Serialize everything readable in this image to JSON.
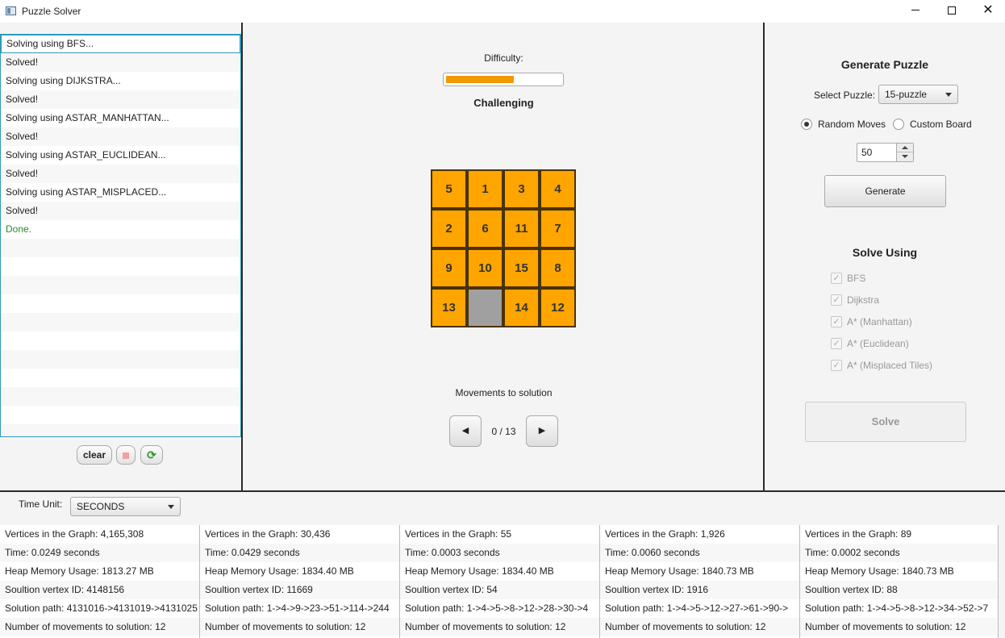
{
  "window": {
    "title": "Puzzle Solver",
    "minimize": "",
    "maximize": "",
    "close": "✕"
  },
  "log": {
    "entries": [
      "Solving using BFS...",
      "Solved!",
      "Solving using DIJKSTRA...",
      "Solved!",
      "Solving using ASTAR_MANHATTAN...",
      "Solved!",
      "Solving using ASTAR_EUCLIDEAN...",
      "Solved!",
      "Solving using ASTAR_MISPLACED...",
      "Solved!",
      "Done."
    ],
    "clear_label": "clear",
    "refresh_glyph": "⟳"
  },
  "center": {
    "difficulty_label": "Difficulty:",
    "difficulty_value": 0.59,
    "difficulty_level": "Challenging",
    "board": {
      "size": 4,
      "tiles": [
        "5",
        "1",
        "3",
        "4",
        "2",
        "6",
        "11",
        "7",
        "9",
        "10",
        "15",
        "8",
        "13",
        "",
        "14",
        "12"
      ]
    },
    "movements_label": "Movements to solution",
    "move_current": "0",
    "move_total": "13",
    "move_counter": "0 / 13",
    "prev_glyph": "◀",
    "next_glyph": "▶"
  },
  "generate": {
    "title": "Generate Puzzle",
    "select_label": "Select Puzzle:",
    "selected_puzzle": "15-puzzle",
    "random_moves_label": "Random Moves",
    "custom_board_label": "Custom Board",
    "selected_mode": "Random Moves",
    "moves_value": "50",
    "generate_label": "Generate"
  },
  "solve": {
    "title": "Solve Using",
    "algorithms": [
      "BFS",
      "Dijkstra",
      "A* (Manhattan)",
      "A* (Euclidean)",
      "A* (Misplaced Tiles)"
    ],
    "check_glyph": "✓",
    "solve_label": "Solve"
  },
  "bottom": {
    "time_unit_label": "Time Unit:",
    "time_unit_value": "SECONDS",
    "stats": [
      [
        "Vertices in the Graph: 4,165,308",
        "Time: 0.0249 seconds",
        "Heap Memory Usage: 1813.27 MB",
        "Soultion vertex ID: 4148156",
        "Solution path: 4131016->4131019->4131025",
        "Number of movements to solution: 12"
      ],
      [
        "Vertices in the Graph: 30,436",
        "Time: 0.0429 seconds",
        "Heap Memory Usage: 1834.40 MB",
        "Soultion vertex ID: 11669",
        "Solution path: 1->4->9->23->51->114->244",
        "Number of movements to solution: 12"
      ],
      [
        "Vertices in the Graph: 55",
        "Time: 0.0003 seconds",
        "Heap Memory Usage: 1834.40 MB",
        "Soultion vertex ID: 54",
        "Solution path: 1->4->5->8->12->28->30->4",
        "Number of movements to solution: 12"
      ],
      [
        "Vertices in the Graph: 1,926",
        "Time: 0.0060 seconds",
        "Heap Memory Usage: 1840.73 MB",
        "Soultion vertex ID: 1916",
        "Solution path: 1->4->5->12->27->61->90->",
        "Number of movements to solution: 12"
      ],
      [
        "Vertices in the Graph: 89",
        "Time: 0.0002 seconds",
        "Heap Memory Usage: 1840.73 MB",
        "Soultion vertex ID: 88",
        "Solution path: 1->4->5->8->12->34->52->7",
        "Number of movements to solution: 12"
      ]
    ]
  },
  "colors": {
    "tile": "#ffa500",
    "tile_blank": "#a0a0a0",
    "progress": "#f09a00",
    "done_text": "#2a8a2a",
    "accent_border": "#2e9bb8"
  }
}
